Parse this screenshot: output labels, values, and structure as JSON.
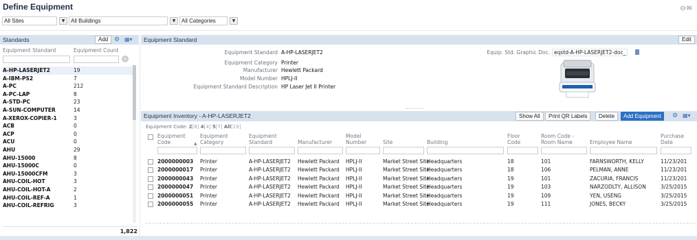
{
  "page": {
    "title": "Define Equipment"
  },
  "filters": {
    "sites": "All Sites",
    "buildings": "All Buildings",
    "categories": "All Categories"
  },
  "standards_panel": {
    "title": "Standards",
    "add_label": "Add",
    "col_standard": "Equipment Standard",
    "col_count": "Equipment Count",
    "rows": [
      {
        "name": "A-HP-LASERJET2",
        "count": "19"
      },
      {
        "name": "A-IBM-PS2",
        "count": "7"
      },
      {
        "name": "A-PC",
        "count": "212"
      },
      {
        "name": "A-PC-LAP",
        "count": "8"
      },
      {
        "name": "A-STD-PC",
        "count": "23"
      },
      {
        "name": "A-SUN-COMPUTER",
        "count": "14"
      },
      {
        "name": "A-XEROX-COPIER-1",
        "count": "3"
      },
      {
        "name": "ACB",
        "count": "0"
      },
      {
        "name": "ACP",
        "count": "0"
      },
      {
        "name": "ACU",
        "count": "0"
      },
      {
        "name": "AHU",
        "count": "29"
      },
      {
        "name": "AHU-15000",
        "count": "8"
      },
      {
        "name": "AHU-15000C",
        "count": "0"
      },
      {
        "name": "AHU-15000CFM",
        "count": "3"
      },
      {
        "name": "AHU-COIL-HOT",
        "count": "3"
      },
      {
        "name": "AHU-COIL-HOT-A",
        "count": "2"
      },
      {
        "name": "AHU-COIL-REF-A",
        "count": "1"
      },
      {
        "name": "AHU-COIL-REFRIG",
        "count": "3"
      }
    ],
    "total": "1,822"
  },
  "standard_panel": {
    "title": "Equipment Standard",
    "edit_label": "Edit",
    "fields": [
      {
        "label": "Equipment Standard",
        "value": "A-HP-LASERJET2"
      },
      {
        "label": "Equipment Category",
        "value": "Printer"
      },
      {
        "label": "Manufacturer",
        "value": "Hewlett Packard"
      },
      {
        "label": "Model Number",
        "value": "HPLJ-II"
      },
      {
        "label": "Equipment Standard Description",
        "value": "HP Laser Jet II Printer"
      }
    ],
    "graphic_label": "Equip. Std. Graphic Doc.",
    "graphic_value": "eqstd-A-HP-LASERJET2-doc_"
  },
  "inventory_panel": {
    "title": "Equipment Inventory - A-HP-LASERJET2",
    "buttons": {
      "show_all": "Show All",
      "print_qr": "Print QR Labels",
      "delete": "Delete",
      "add": "Add Equipment"
    },
    "code_filter": {
      "label": "Equipment Code:",
      "groups": [
        {
          "v": "2",
          "n": "[8]"
        },
        {
          "v": "4",
          "n": "[4]"
        },
        {
          "v": "5",
          "n": "[7]"
        },
        {
          "v": "All",
          "n": "[19]"
        }
      ]
    },
    "columns": [
      "Equipment Code",
      "Equipment Category",
      "Equipment Standard",
      "Manufacturer",
      "Model Number",
      "Site",
      "Building",
      "Floor Code",
      "Room Code - Room Name",
      "Employee Name",
      "Purchase Date"
    ],
    "rows": [
      {
        "code": "2000000003",
        "category": "Printer",
        "standard": "A-HP-LASERJET2",
        "manufacturer": "Hewlett Packard",
        "model": "HPLJ-II",
        "site": "Market Street Site",
        "building": "Headquarters",
        "floor": "18",
        "room": "101",
        "employee": "FARNSWORTH, KELLY",
        "date": "11/23/201"
      },
      {
        "code": "2000000017",
        "category": "Printer",
        "standard": "A-HP-LASERJET2",
        "manufacturer": "Hewlett Packard",
        "model": "HPLJ-II",
        "site": "Market Street Site",
        "building": "Headquarters",
        "floor": "18",
        "room": "106",
        "employee": "PELMAN, ANNE",
        "date": "11/23/201"
      },
      {
        "code": "2000000043",
        "category": "Printer",
        "standard": "A-HP-LASERJET2",
        "manufacturer": "Hewlett Packard",
        "model": "HPLJ-II",
        "site": "Market Street Site",
        "building": "Headquarters",
        "floor": "19",
        "room": "101",
        "employee": "ZACURIA, FRANCIS",
        "date": "11/23/201"
      },
      {
        "code": "2000000047",
        "category": "Printer",
        "standard": "A-HP-LASERJET2",
        "manufacturer": "Hewlett Packard",
        "model": "HPLJ-II",
        "site": "Market Street Site",
        "building": "Headquarters",
        "floor": "19",
        "room": "103",
        "employee": "NARZODLTY, ALLISON",
        "date": "3/25/2015"
      },
      {
        "code": "2000000051",
        "category": "Printer",
        "standard": "A-HP-LASERJET2",
        "manufacturer": "Hewlett Packard",
        "model": "HPLJ-II",
        "site": "Market Street Site",
        "building": "Headquarters",
        "floor": "19",
        "room": "109",
        "employee": "YEN, USENG",
        "date": "3/25/2015"
      },
      {
        "code": "2000000055",
        "category": "Printer",
        "standard": "A-HP-LASERJET2",
        "manufacturer": "Hewlett Packard",
        "model": "HPLJ-II",
        "site": "Market Street Site",
        "building": "Headquarters",
        "floor": "19",
        "room": "111",
        "employee": "JONES, BECKY",
        "date": "3/25/2015"
      }
    ]
  },
  "colors": {
    "panel_header": "#d7e2ee",
    "accent_button": "#2d6fc4",
    "title": "#1c2d44"
  }
}
